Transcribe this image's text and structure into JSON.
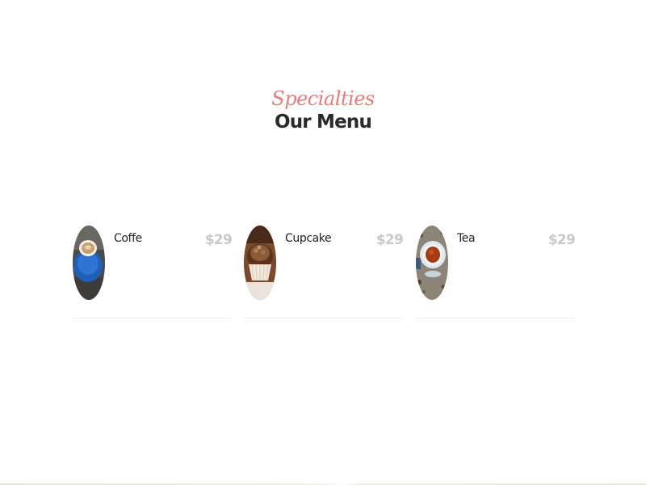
{
  "header": {
    "subtitle": "Specialties",
    "title": "Our Menu"
  },
  "menu": {
    "items": [
      {
        "name": "Coffe",
        "price": "$29",
        "image_icon": "coffee-cup-image"
      },
      {
        "name": "Cupcake",
        "price": "$29",
        "image_icon": "cupcake-image"
      },
      {
        "name": "Tea",
        "price": "$29",
        "image_icon": "tea-cup-image"
      }
    ]
  },
  "colors": {
    "accent": "#e87b7b",
    "title": "#2a2a2a",
    "price": "#c9c9c9",
    "divider": "#efefef"
  }
}
